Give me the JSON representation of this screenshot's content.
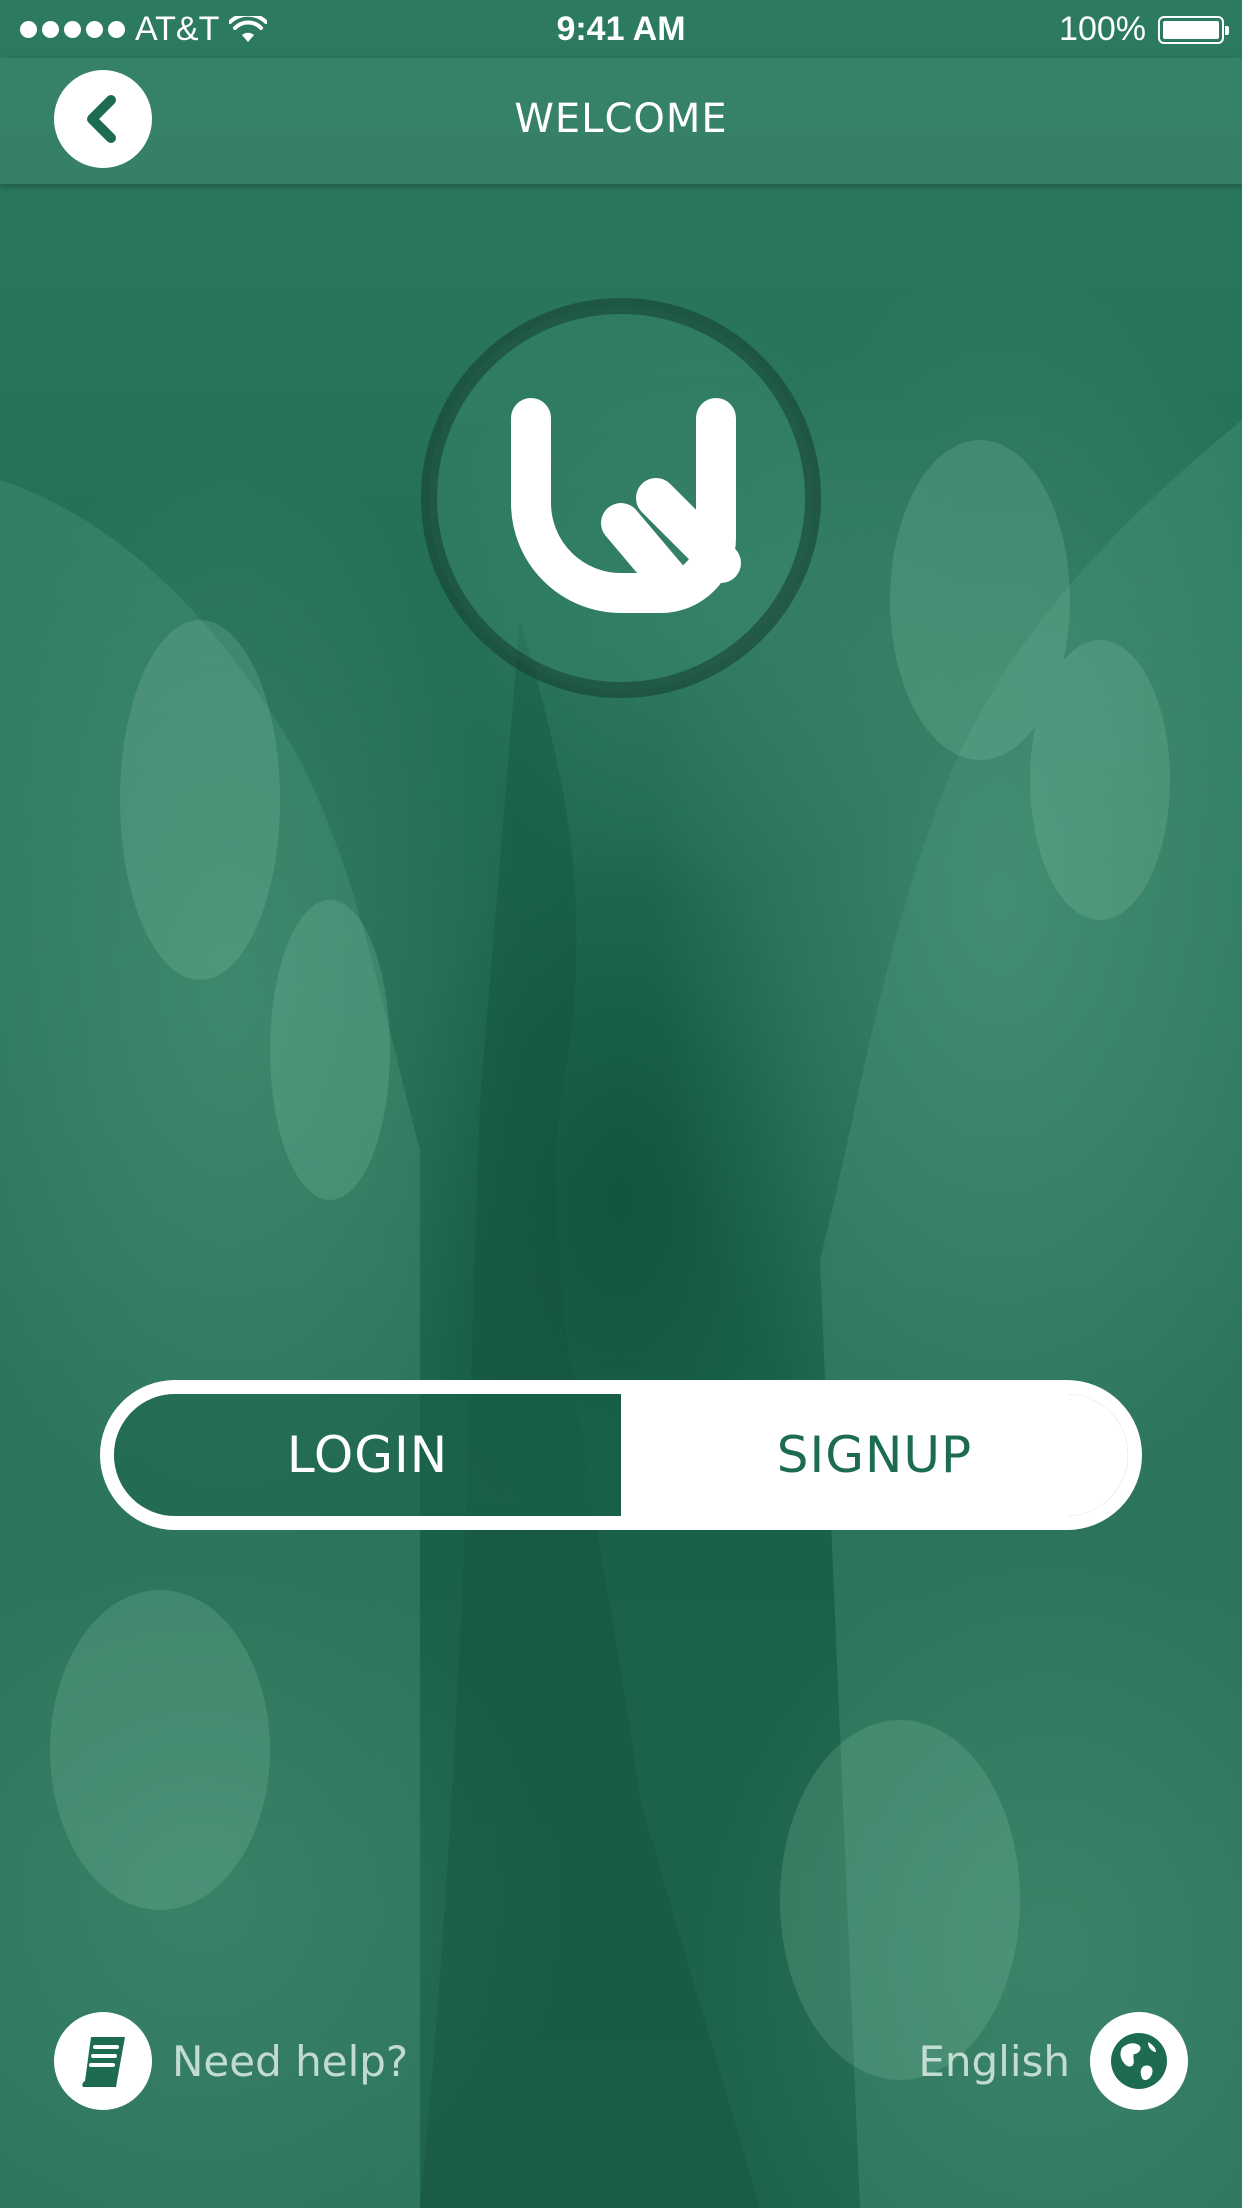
{
  "status_bar": {
    "carrier": "AT&T",
    "time": "9:41 AM",
    "battery": "100%",
    "battery_level": 1.0
  },
  "nav": {
    "title": "WELCOME",
    "back_icon": "chevron-left-icon"
  },
  "logo": {
    "icon": "app-logo"
  },
  "auth": {
    "login_label": "LOGIN",
    "signup_label": "SIGNUP",
    "selected": "SIGNUP"
  },
  "footer": {
    "help_label": "Need help?",
    "help_icon": "book-icon",
    "language_label": "English",
    "language_icon": "globe-icon"
  },
  "colors": {
    "primary": "#1d6b52",
    "nav_bar": "#38826a",
    "white": "#ffffff"
  }
}
